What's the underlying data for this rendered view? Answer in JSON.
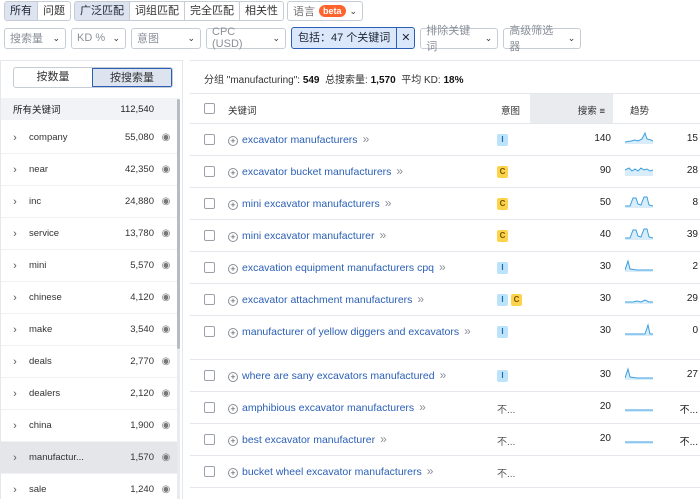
{
  "tabs": {
    "match": [
      "所有",
      "问题"
    ],
    "match_selected": 0,
    "type": [
      "广泛匹配",
      "词组匹配",
      "完全匹配",
      "相关性"
    ],
    "type_selected": 0,
    "language": "语言",
    "beta": "beta"
  },
  "filters": {
    "volume": "搜索量",
    "kd": "KD %",
    "intent": "意图",
    "cpc": "CPC (USD)",
    "include": "包括：47 个关键词",
    "exclude": "排除关键词",
    "advanced": "高级筛选器"
  },
  "sidebar": {
    "by_count": "按数量",
    "by_volume": "按搜索量",
    "all_label": "所有关键词",
    "all_value": "112,540",
    "groups": [
      {
        "name": "company",
        "value": "55,080"
      },
      {
        "name": "near",
        "value": "42,350"
      },
      {
        "name": "inc",
        "value": "24,880"
      },
      {
        "name": "service",
        "value": "13,780"
      },
      {
        "name": "mini",
        "value": "5,570"
      },
      {
        "name": "chinese",
        "value": "4,120"
      },
      {
        "name": "make",
        "value": "3,540"
      },
      {
        "name": "deals",
        "value": "2,770"
      },
      {
        "name": "dealers",
        "value": "2,120"
      },
      {
        "name": "china",
        "value": "1,900"
      },
      {
        "name": "manufactur...",
        "value": "1,570"
      },
      {
        "name": "sale",
        "value": "1,240"
      }
    ],
    "selected_index": 10
  },
  "summary": {
    "group_label": "分组 \"manufacturing\":",
    "group_count": "549",
    "total_label": "总搜索量:",
    "total_value": "1,570",
    "kd_label": "平均 KD:",
    "kd_value": "18%"
  },
  "table": {
    "headers": {
      "keyword": "关键词",
      "intent": "意图",
      "volume": "搜索",
      "trend": "趋势"
    },
    "rows": [
      {
        "keyword": "excavator manufacturers",
        "intent": [
          "I"
        ],
        "volume": "140",
        "kd": "15",
        "trend": "peaky"
      },
      {
        "keyword": "excavator bucket manufacturers",
        "intent": [
          "C"
        ],
        "volume": "90",
        "kd": "28",
        "trend": "wavy"
      },
      {
        "keyword": "mini excavator manufacturers",
        "intent": [
          "C"
        ],
        "volume": "50",
        "kd": "8",
        "trend": "bumpy"
      },
      {
        "keyword": "mini excavator manufacturer",
        "intent": [
          "C"
        ],
        "volume": "40",
        "kd": "39",
        "trend": "bumpy"
      },
      {
        "keyword": "excavation equipment manufacturers cpq",
        "intent": [
          "I"
        ],
        "volume": "30",
        "kd": "2",
        "trend": "drop"
      },
      {
        "keyword": "excavator attachment manufacturers",
        "intent": [
          "I",
          "C"
        ],
        "volume": "30",
        "kd": "29",
        "trend": "low"
      },
      {
        "keyword": "manufacturer of yellow diggers and excavators",
        "intent": [
          "I"
        ],
        "volume": "30",
        "kd": "0",
        "trend": "spike"
      },
      {
        "keyword": "where are sany excavators manufactured",
        "intent": [
          "I"
        ],
        "volume": "30",
        "kd": "27",
        "trend": "drop"
      },
      {
        "keyword": "amphibious excavator manufacturers",
        "intent_text": "不...",
        "volume": "20",
        "kd": "不...",
        "trend": "flat"
      },
      {
        "keyword": "best excavator manufacturer",
        "intent_text": "不...",
        "volume": "20",
        "kd": "不...",
        "trend": "flat"
      },
      {
        "keyword": "bucket wheel excavator manufacturers",
        "intent_text": "不...",
        "volume": "",
        "kd": "",
        "trend": "none"
      }
    ]
  },
  "colors": {
    "accent": "#2a5fb5",
    "intent_i": "#bde3fb",
    "intent_c": "#fcd34b",
    "trend": "#3b9fe0"
  }
}
